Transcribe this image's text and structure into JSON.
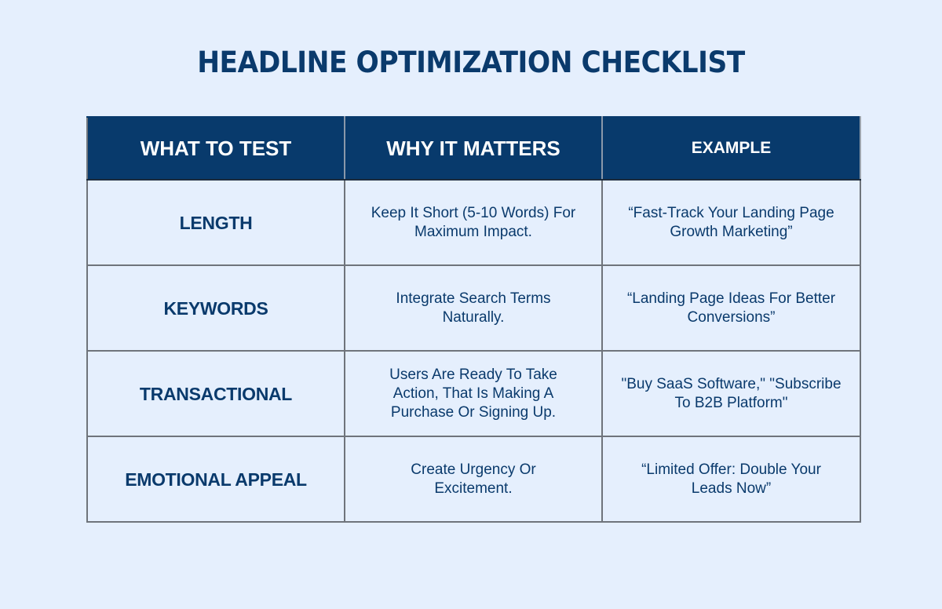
{
  "title": "HEADLINE OPTIMIZATION CHECKLIST",
  "table": {
    "headers": [
      "WHAT TO TEST",
      "WHY IT MATTERS",
      "EXAMPLE"
    ],
    "rows": [
      {
        "test": "LENGTH",
        "why": "Keep It Short (5-10 Words) For Maximum Impact.",
        "example": "“Fast-Track Your Landing Page Growth Marketing”"
      },
      {
        "test": "KEYWORDS",
        "why": "Integrate Search Terms Naturally.",
        "example": "“Landing Page Ideas For Better Conversions”"
      },
      {
        "test": "TRANSACTIONAL",
        "why": "Users Are Ready To Take Action, That Is Making A Purchase Or Signing Up.",
        "example": "\"Buy SaaS Software,\" \"Subscribe To B2B Platform\""
      },
      {
        "test": "EMOTIONAL APPEAL",
        "why": "Create Urgency Or Excitement.",
        "example": "“Limited Offer: Double Your Leads Now”"
      }
    ]
  },
  "colors": {
    "background": "#e5effd",
    "header_bg": "#083a6c",
    "text": "#0a3a6c",
    "border": "#6f747b"
  }
}
